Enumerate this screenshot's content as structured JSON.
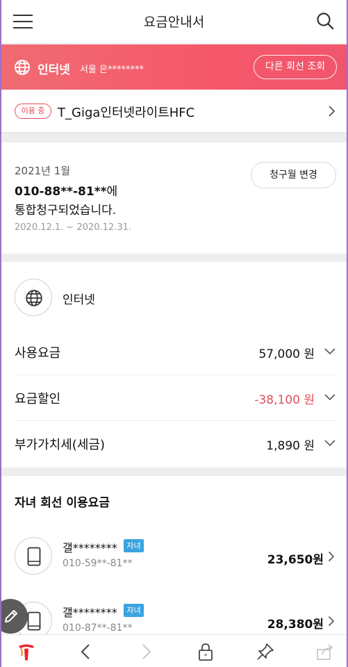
{
  "header": {
    "title": "요금안내서",
    "menu_icon": "hamburger-menu-icon",
    "search_icon": "search-icon"
  },
  "banner": {
    "service": "인터넷",
    "account": "서울 은********",
    "other_line_button": "다른 회선 조회",
    "color": "#f5586a"
  },
  "plan": {
    "status_badge": "이용 중",
    "name": "T_Giga인터넷라이트HFC"
  },
  "bill": {
    "month": "2021년 1월",
    "number": "010-88**-81**",
    "number_suffix": "에",
    "description": "통합청구되었습니다.",
    "period": "2020.12.1. ~ 2020.12.31.",
    "change_month_button": "청구월 변경"
  },
  "charges": {
    "service_label": "인터넷",
    "rows": [
      {
        "label": "사용요금",
        "amount": "57,000 원",
        "color": "#111111"
      },
      {
        "label": "요금할인",
        "amount": "-38,100 원",
        "color": "#e0505a"
      },
      {
        "label": "부가가치세(세금)",
        "amount": "1,890 원",
        "color": "#111111"
      }
    ]
  },
  "children": {
    "title": "자녀 회선 이용요금",
    "items": [
      {
        "name": "갤********",
        "tag": "자녀",
        "number": "010-59**-81**",
        "amount": "23,650원"
      },
      {
        "name": "갤********",
        "tag": "자녀",
        "number": "010-87**-81**",
        "amount": "28,380원"
      }
    ]
  },
  "bottom_bar": {
    "icons": [
      "t-logo-icon",
      "back-arrow-icon",
      "forward-arrow-icon",
      "lock-icon",
      "pin-icon",
      "share-icon"
    ]
  }
}
